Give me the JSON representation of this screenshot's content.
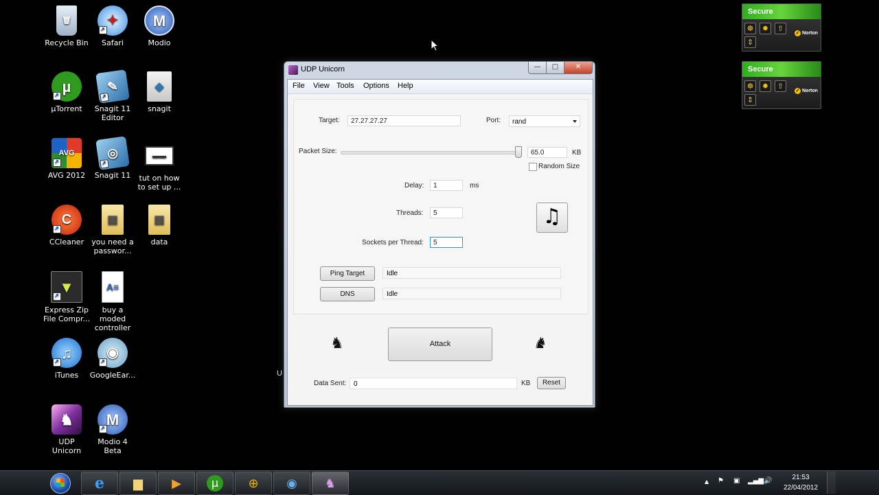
{
  "desktop": {
    "icons": [
      {
        "label": "Recycle Bin"
      },
      {
        "label": "Safari"
      },
      {
        "label": "Modio"
      },
      {
        "label": "µTorrent"
      },
      {
        "label": "Snagit 11 Editor"
      },
      {
        "label": "snagit"
      },
      {
        "label": "AVG 2012"
      },
      {
        "label": "Snagit 11"
      },
      {
        "label": "tut on how to set up ..."
      },
      {
        "label": "CCleaner"
      },
      {
        "label": "you need a passwor..."
      },
      {
        "label": "data"
      },
      {
        "label": "Express Zip File Compr..."
      },
      {
        "label": "buy a moded controller"
      },
      {
        "label": "iTunes"
      },
      {
        "label": "GoogleEar..."
      },
      {
        "label": "UDP Unicorn"
      },
      {
        "label": "Modio 4 Beta"
      }
    ],
    "behind_text": "U"
  },
  "norton": {
    "status": "Secure",
    "brand": "Norton"
  },
  "window": {
    "title": "UDP Unicorn",
    "minimize": "—",
    "maximize": "□",
    "close": "✕",
    "menu": [
      "File",
      "View",
      "Tools",
      "Options",
      "Help"
    ],
    "target_label": "Target:",
    "target_value": "27.27.27.27",
    "port_label": "Port:",
    "port_value": "rand",
    "packet_size_label": "Packet Size:",
    "packet_size_value": "65.0",
    "packet_size_unit": "KB",
    "packet_size_fraction": 1.0,
    "random_size_label": "Random Size",
    "random_size_checked": false,
    "delay_label": "Delay:",
    "delay_value": "1",
    "delay_unit": "ms",
    "threads_label": "Threads:",
    "threads_value": "5",
    "sockets_label": "Sockets per Thread:",
    "sockets_value": "5",
    "music_symbol": "♫",
    "ping_button": "Ping Target",
    "ping_status": "Idle",
    "dns_button": "DNS",
    "dns_status": "Idle",
    "attack_button": "Attack",
    "unicorn_symbol": "♞",
    "data_sent_label": "Data Sent:",
    "data_sent_value": "0",
    "data_sent_unit": "KB",
    "reset_button": "Reset"
  },
  "taskbar": {
    "time": "21:53",
    "date": "22/04/2012",
    "tray_arrow": "▲"
  }
}
